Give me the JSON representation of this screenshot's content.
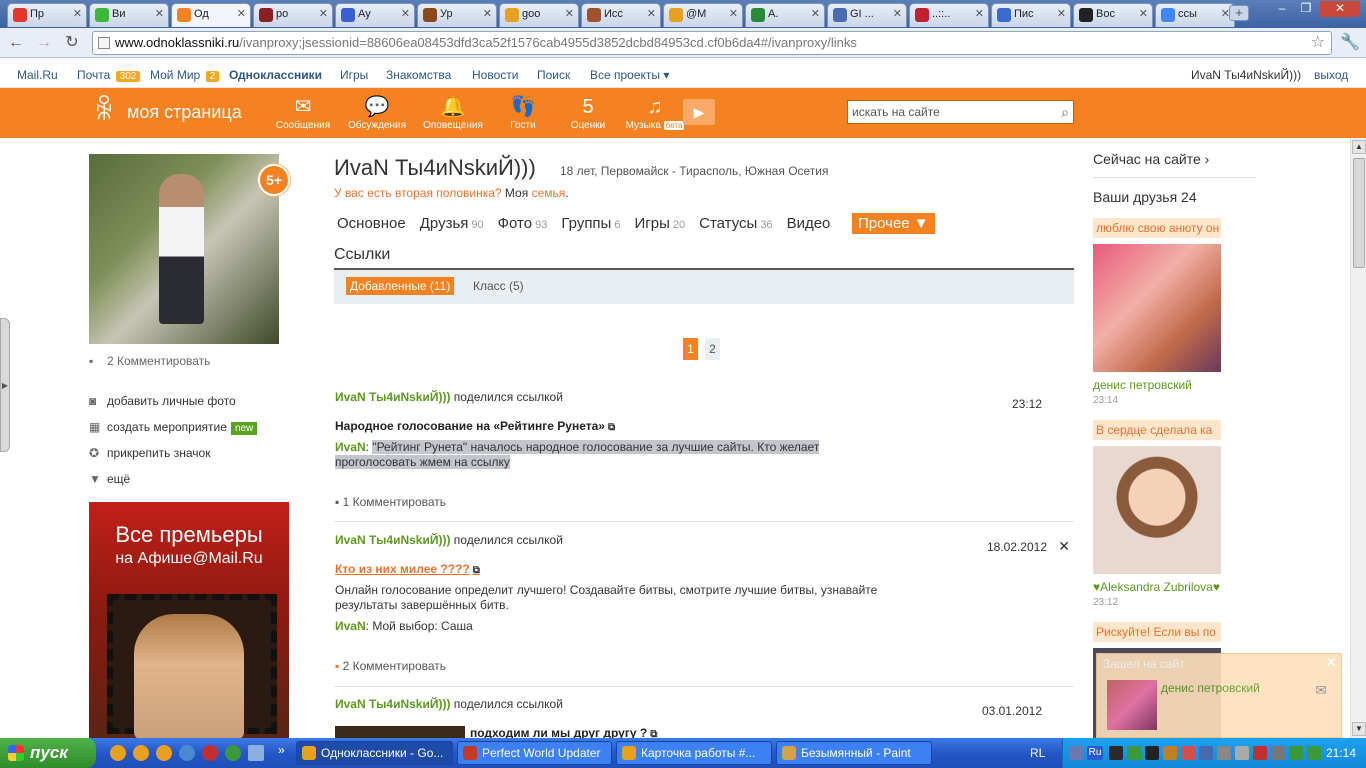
{
  "browser": {
    "tabs": [
      {
        "label": "Пр",
        "color": "#e03a2f"
      },
      {
        "label": "Ви",
        "color": "#3bb73a"
      },
      {
        "label": "Од",
        "color": "#f58220"
      },
      {
        "label": "ро",
        "color": "#8b2020"
      },
      {
        "label": "Ау",
        "color": "#3a5fd0"
      },
      {
        "label": "Ур",
        "color": "#8a4a1a"
      },
      {
        "label": "goo",
        "color": "#e8a020"
      },
      {
        "label": "Исс",
        "color": "#a0522d"
      },
      {
        "label": "@М",
        "color": "#e8a020"
      },
      {
        "label": "А.",
        "color": "#2a8a3a"
      },
      {
        "label": "GI ...",
        "color": "#4a6ab0"
      },
      {
        "label": "..::..",
        "color": "#c02030"
      },
      {
        "label": "Пис",
        "color": "#3a6ad0"
      },
      {
        "label": "Вос",
        "color": "#222222"
      },
      {
        "label": "ссы",
        "color": "#4285f4"
      }
    ],
    "new_tab_label": "+",
    "url_host": "www.odnoklassniki.ru",
    "url_path": "/ivanproxy;jsessionid=88606ea08453dfd3ca52f1576cab4955d3852dcbd84953cd.cf0b6da4#/ivanproxy/links"
  },
  "portal": {
    "mailru": "Mail.Ru",
    "mail": "Почта",
    "mail_count": "302",
    "myworld": "Мой Мир",
    "myworld_count": "2",
    "ok": "Одноклассники",
    "games": "Игры",
    "dating": "Знакомства",
    "news": "Новости",
    "search": "Поиск",
    "all_projects": "Все проекты ▾",
    "user": "ИvaN Ты4иNskиЙ)))",
    "logout": "выход"
  },
  "header": {
    "logo_text": "моя страница",
    "nav": [
      {
        "label": "Сообщения",
        "icon": "envelope-icon",
        "glyph": "✉"
      },
      {
        "label": "Обсуждения",
        "icon": "chat-icon",
        "glyph": "💬"
      },
      {
        "label": "Оповещения",
        "icon": "bell-icon",
        "glyph": "🔔"
      },
      {
        "label": "Гости",
        "icon": "footprints-icon",
        "glyph": "👣"
      },
      {
        "label": "Оценки",
        "icon": "rating-five-icon",
        "glyph": "5"
      },
      {
        "label": "Музыка",
        "icon": "music-note-icon",
        "glyph": "♫"
      }
    ],
    "music_beta": "бета",
    "search_placeholder": "искать на сайте"
  },
  "left": {
    "badge": "5+",
    "comments": "2 Комментировать",
    "add_photo": "добавить личные фото",
    "create_event": "создать мероприятие",
    "new_tag": "new",
    "pin_badge": "прикрепить значок",
    "more": "ещё",
    "ad_line1": "Все премьеры",
    "ad_line2": "на Афише@Mail.Ru"
  },
  "profile": {
    "name": "ИvaN Ты4иNskиЙ)))",
    "meta": "18 лет, Первомайск - Тирасполь, Южная Осетия",
    "half_question": "У вас есть вторая половинка?",
    "my": "Моя",
    "family": "семья",
    "tabs": [
      {
        "label": "Основное",
        "count": ""
      },
      {
        "label": "Друзья",
        "count": "90"
      },
      {
        "label": "Фото",
        "count": "93"
      },
      {
        "label": "Группы",
        "count": "6"
      },
      {
        "label": "Игры",
        "count": "20"
      },
      {
        "label": "Статусы",
        "count": "36"
      },
      {
        "label": "Видео",
        "count": ""
      }
    ],
    "tab_more": "Прочее ▼",
    "section_title": "Ссылки",
    "subtab_added": "Добавленные (11)",
    "subtab_class": "Класс (5)",
    "page_1": "1",
    "page_2": "2"
  },
  "posts": [
    {
      "author": "ИvaN Ты4иNskиЙ)))",
      "shared": "поделился ссылкой",
      "time": "23:12",
      "title": "Народное голосование на «Рейтинге Рунета»",
      "comment_author": "ИvaN",
      "text_line1": "\"Рейтинг Рунета\" началось народное голосование за лучшие сайты. Кто желает",
      "text_line2": "проголосовать жмем на ссылку",
      "comments": "1 Комментировать"
    },
    {
      "author": "ИvaN Ты4иNskиЙ)))",
      "shared": "поделился ссылкой",
      "time": "18.02.2012",
      "title": "Кто из них милее ????",
      "desc": "Онлайн голосование определит лучшего! Создавайте битвы, смотрите лучшие битвы, узнавайте результаты завершённых битв.",
      "comment_author": "ИvaN",
      "comment_text": "Мой выбор: Саша",
      "comments": "2 Комментировать"
    },
    {
      "author": "ИvaN Ты4иNskиЙ)))",
      "shared": "поделился ссылкой",
      "time": "03.01.2012",
      "title": "подходим ли мы друг другу ?"
    }
  ],
  "right": {
    "online_now": "Сейчас на сайте ›",
    "friends": "Ваши друзья 24",
    "friend_cards": [
      {
        "status": "люблю свою анюту он",
        "name": "денис петровский",
        "time": "23:14"
      },
      {
        "status": "В сердце сделала ка",
        "name": "♥Aleksandra Zubrilova♥",
        "time": "23:12"
      },
      {
        "status": "Рискуйте! Если вы по"
      }
    ],
    "popup_title": "Зашел на сайт",
    "popup_name": "денис петровский"
  },
  "taskbar": {
    "start": "пуск",
    "tasks": [
      {
        "label": "Одноклассники - Go...",
        "color": "#e8a020"
      },
      {
        "label": "Perfect World Updater",
        "color": "#c0392b"
      },
      {
        "label": "Карточка работы #...",
        "color": "#e8a020"
      },
      {
        "label": "Безымянный - Paint",
        "color": "#d4a24a"
      }
    ],
    "lang": "RL",
    "tray_lang": "Ru",
    "clock": "21:14"
  }
}
